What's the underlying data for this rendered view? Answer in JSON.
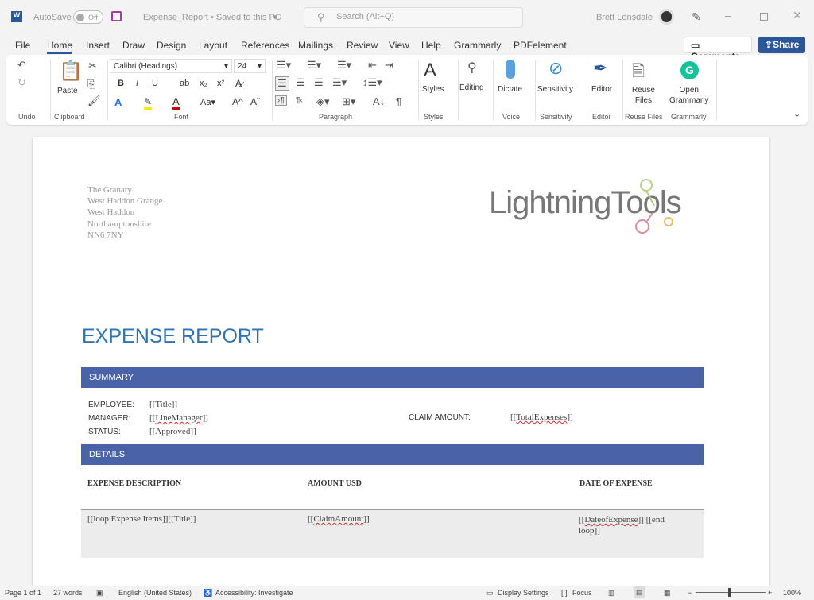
{
  "titlebar": {
    "autosave": "AutoSave",
    "toggle": "Off",
    "doc_title": "Expense_Report • Saved to this PC",
    "search_placeholder": "Search (Alt+Q)",
    "user": "Brett Lonsdale"
  },
  "tabs": [
    "File",
    "Home",
    "Insert",
    "Draw",
    "Design",
    "Layout",
    "References",
    "Mailings",
    "Review",
    "View",
    "Help",
    "Grammarly",
    "PDFelement"
  ],
  "buttons": {
    "comments": "Comments",
    "share": "Share"
  },
  "ribbon": {
    "font_name": "Calibri (Headings)",
    "font_size": "24",
    "paste": "Paste",
    "styles": "Styles",
    "editing": "Editing",
    "dictate": "Dictate",
    "sensitivity": "Sensitivity",
    "editor": "Editor",
    "reuse1": "Reuse",
    "reuse2": "Files",
    "grammarly1": "Open",
    "grammarly2": "Grammarly",
    "groups": [
      "Undo",
      "Clipboard",
      "Font",
      "Paragraph",
      "Styles",
      "Voice",
      "Sensitivity",
      "Editor",
      "Reuse Files",
      "Grammarly"
    ]
  },
  "doc": {
    "address": [
      "The Granary",
      "West Haddon Grange",
      "West Haddon",
      "Northamptonshire",
      "NN6 7NY"
    ],
    "logo": "LightningTools",
    "title": "EXPENSE REPORT",
    "summary": "SUMMARY",
    "employee_lbl": "EMPLOYEE:",
    "employee": "[[Title]]",
    "manager_lbl": "MANAGER:",
    "manager_pre": "[[",
    "manager": "LineManager",
    "manager_post": "]]",
    "status_lbl": "STATUS:",
    "status": "[[Approved]]",
    "claim_lbl": "CLAIM AMOUNT:",
    "claim_pre": "[[",
    "claim": "TotalExpenses",
    "claim_post": "]]",
    "details": "DETAILS",
    "col1": "EXPENSE DESCRIPTION",
    "col2": "AMOUNT USD",
    "col3": "DATE OF EXPENSE",
    "row_desc": "[[loop Expense Items]][[Title]]",
    "row_amt_pre": "[[",
    "row_amt": "ClaimAmount",
    "row_amt_post": "]]",
    "row_date_pre": "[[",
    "row_date": "DateofExpense",
    "row_date_post": "]] [[end loop]]"
  },
  "status": {
    "page": "Page 1 of 1",
    "words": "27 words",
    "language": "English (United States)",
    "accessibility": "Accessibility: Investigate",
    "display": "Display Settings",
    "focus": "Focus",
    "zoom": "100%"
  },
  "colors": {
    "accent": "#2b579a",
    "bar": "#4a62a8",
    "title": "#2e74b5"
  }
}
